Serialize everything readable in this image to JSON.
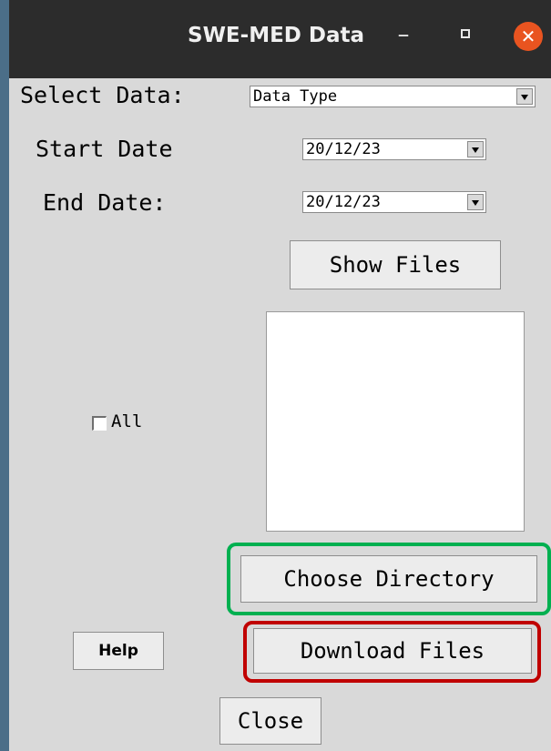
{
  "window": {
    "title": "SWE-MED Data",
    "minimize_glyph": "–",
    "close_glyph": "✕",
    "colors": {
      "titlebar": "#2c2c2c",
      "close_button": "#e95420",
      "body": "#d9d9d9",
      "desktop": "#4b6e88"
    }
  },
  "form": {
    "select_data_label": "Select Data:",
    "data_type_value": "Data Type",
    "start_date_label": "Start Date",
    "start_date_value": "20/12/23",
    "end_date_label": "End Date:",
    "end_date_value": "20/12/23",
    "all_checkbox_label": "All",
    "all_checked": false
  },
  "buttons": {
    "show_files": "Show Files",
    "choose_directory": "Choose Directory",
    "help": "Help",
    "download_files": "Download Files",
    "close": "Close"
  },
  "highlights": {
    "choose_directory_color": "#00b050",
    "download_files_color": "#c00000"
  }
}
